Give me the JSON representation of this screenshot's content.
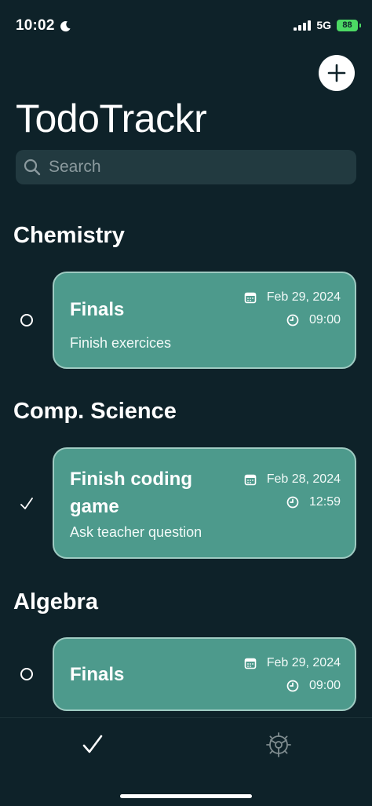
{
  "status_bar": {
    "time": "10:02",
    "network": "5G",
    "battery": "88"
  },
  "header": {
    "title": "TodoTrackr"
  },
  "search": {
    "placeholder": "Search"
  },
  "sections": [
    {
      "title": "Chemistry",
      "task": {
        "title": "Finals",
        "note": "Finish exercices",
        "date": "Feb 29, 2024",
        "time": "09:00",
        "completed": false
      }
    },
    {
      "title": "Comp. Science",
      "task": {
        "title": "Finish coding game",
        "note": "Ask teacher question",
        "date": "Feb 28, 2024",
        "time": "12:59",
        "completed": true
      }
    },
    {
      "title": "Algebra",
      "task": {
        "title": "Finals",
        "note": "",
        "date": "Feb 29, 2024",
        "time": "09:00",
        "completed": false
      }
    }
  ],
  "icons": {
    "moon": "moon-icon",
    "signal": "signal-icon",
    "battery": "battery-icon",
    "add": "plus-icon",
    "search": "search-icon",
    "calendar": "calendar-icon",
    "clock": "clock-icon",
    "tasks_tab": "checkmark-icon",
    "settings_tab": "gear-icon"
  },
  "colors": {
    "background": "#0e2229",
    "card": "#4d9a8c",
    "card_border": "#9fcbc2",
    "search_bg": "#223a40",
    "battery": "#4cd964"
  }
}
